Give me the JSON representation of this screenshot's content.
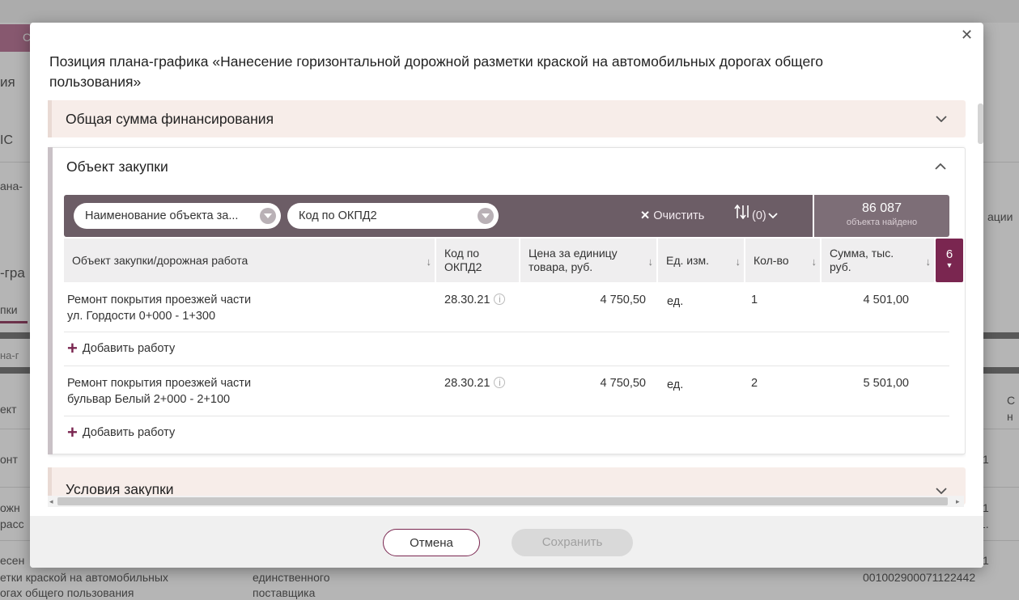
{
  "background": {
    "tab_fragment": "С",
    "heading_fragment": "ия",
    "label_fragment_1": "ІС",
    "label_fragment_2": "ана-",
    "col_fragment_right": "ации",
    "section_fragment": "-гра",
    "tab_link_fragment": "пки",
    "subtab_fragment": "на-г",
    "table_col_fragment": "ект",
    "right_col_fragment": "С",
    "right_col_fragment2": "н",
    "row1_fragment": "онт",
    "row1_right": "1",
    "row2_fragment_a": "ожн",
    "row2_fragment_b": "расс",
    "row2_right": "1",
    "row2_right_b": "1.",
    "row3_fragment": "есен",
    "row3_right": "1",
    "bottom_text_1a": "етки краской на автомобильных",
    "bottom_text_1b": "огах общего пользования",
    "bottom_text_2a": "единственного",
    "bottom_text_2b": "поставщика",
    "bottom_code": "001002900071122442"
  },
  "modal": {
    "title": "Позиция плана-графика  «Нанесение горизонтальной дорожной разметки краской на автомобильных дорогах общего пользования»",
    "close_icon": "close-icon",
    "sections": {
      "financing": "Общая сумма финансирования",
      "purchase_object": "Объект закупки",
      "conditions": "Условия закупки"
    },
    "filters": {
      "name_filter": "Наименование объекта за...",
      "okpd_filter": "Код по ОКПД2",
      "clear_label": "Очистить",
      "sort_label": "(0)"
    },
    "found": {
      "count": "86 087",
      "label": "объекта найдено"
    },
    "table": {
      "columns": [
        "Объект закупки/дорожная работа",
        "Код по ОКПД2",
        "Цена за единицу товара, руб.",
        "Ед. изм.",
        "Кол-во",
        "Сумма, тыс. руб."
      ],
      "more_columns": "6",
      "rows": [
        {
          "object_line1": "Ремонт покрытия проезжей части",
          "object_line2": "ул. Гордости 0+000 - 1+300",
          "okpd": "28.30.21",
          "price": "4 750,50",
          "unit": "ед.",
          "qty": "1",
          "sum": "4 501,00"
        },
        {
          "object_line1": "Ремонт покрытия проезжей части",
          "object_line2": "бульвар Белый  2+000 - 2+100",
          "okpd": "28.30.21",
          "price": "4 750,50",
          "unit": "ед.",
          "qty": "2",
          "sum": "5 501,00"
        }
      ],
      "add_work_label": "Добавить работу"
    },
    "buttons": {
      "cancel": "Отмена",
      "save": "Сохранить"
    }
  }
}
